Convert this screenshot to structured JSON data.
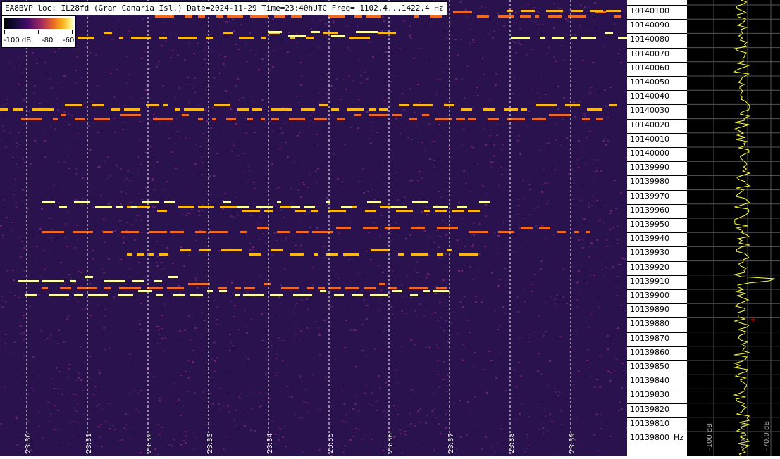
{
  "header": {
    "text": "EA8BVP loc: IL28fd (Gran Canaria Isl.) Date=2024-11-29 Time=23:40hUTC Freq= 1102.4...1422.4 Hz"
  },
  "colorbar": {
    "labels": [
      "-100 dB",
      "-80",
      "-60"
    ]
  },
  "time_axis": {
    "labels": [
      "23:30",
      "23:31",
      "23:32",
      "23:33",
      "23:34",
      "23:35",
      "23:36",
      "23:37",
      "23:38",
      "23:39"
    ]
  },
  "freq_axis": {
    "labels": [
      "10140100",
      "10140090",
      "10140080",
      "10140070",
      "10140060",
      "10140050",
      "10140040",
      "10140030",
      "10140020",
      "10140010",
      "10140000",
      "10139990",
      "10139980",
      "10139970",
      "10139960",
      "10139950",
      "10139940",
      "10139930",
      "10139920",
      "10139910",
      "10139900",
      "10139890",
      "10139880",
      "10139870",
      "10139860",
      "10139850",
      "10139840",
      "10139830",
      "10139820",
      "10139810",
      "10139800"
    ],
    "unit": "Hz"
  },
  "spectrum": {
    "db_labels": [
      "-100 dB",
      "-90.0 dB",
      "-70.0 dB"
    ]
  },
  "colors": {
    "background": "#2a124f",
    "signal_bright": "#fcffa4",
    "signal_mid": "#fbb61a",
    "trace": "#ffff40",
    "marker": "#ff0000"
  }
}
